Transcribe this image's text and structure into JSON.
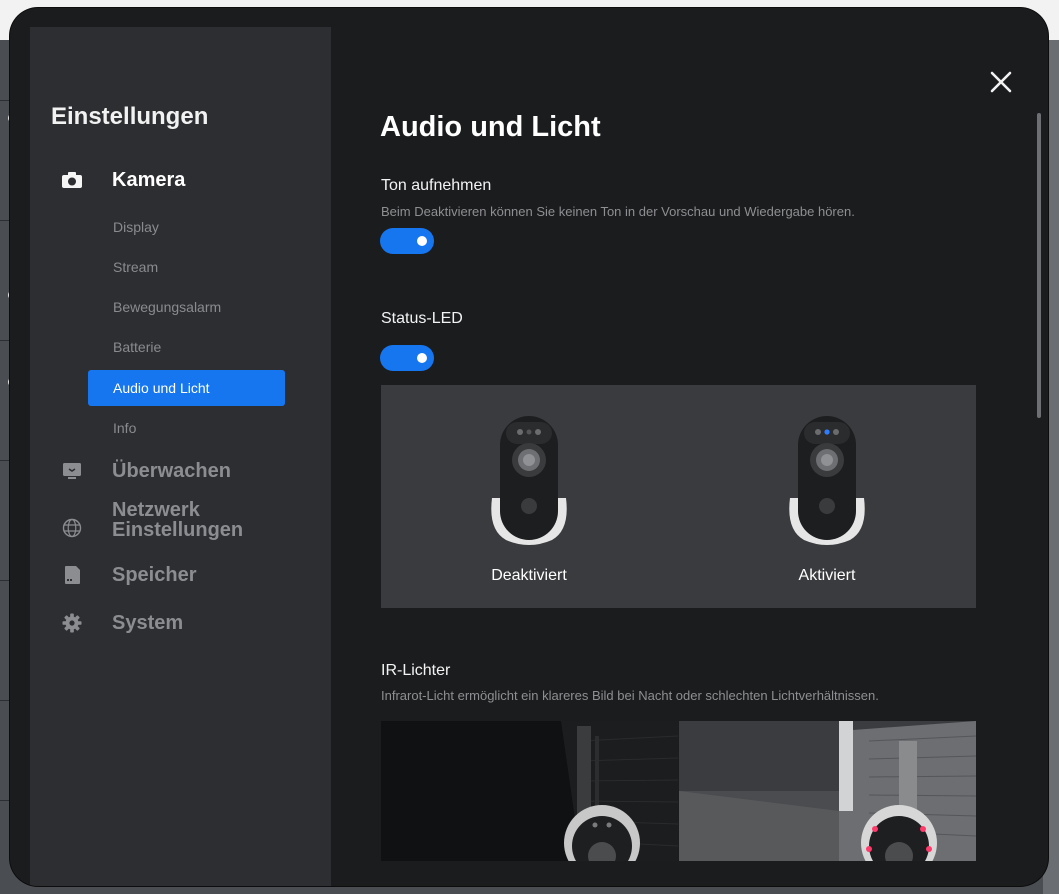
{
  "sidebar": {
    "title": "Einstellungen",
    "sections": [
      {
        "label": "Kamera",
        "icon": "camera-icon",
        "active": true
      },
      {
        "label": "Überwachen",
        "icon": "monitor-icon",
        "active": false
      },
      {
        "label": "Netzwerk\nEinstellungen",
        "icon": "globe-icon",
        "active": false
      },
      {
        "label": "Speicher",
        "icon": "sd-card-icon",
        "active": false
      },
      {
        "label": "System",
        "icon": "gear-icon",
        "active": false
      }
    ],
    "camera_items": [
      {
        "label": "Display"
      },
      {
        "label": "Stream"
      },
      {
        "label": "Bewegungsalarm"
      },
      {
        "label": "Batterie"
      },
      {
        "label": "Audio und Licht",
        "selected": true
      },
      {
        "label": "Info"
      }
    ]
  },
  "content": {
    "page_title": "Audio und Licht",
    "close_icon": "close-icon",
    "audio": {
      "label": "Ton aufnehmen",
      "description": "Beim Deaktivieren können Sie keinen Ton in der Vorschau und Wiedergabe hören.",
      "enabled": true
    },
    "status_led": {
      "label": "Status-LED",
      "enabled": true,
      "preview": {
        "off_label": "Deaktiviert",
        "on_label": "Aktiviert"
      }
    },
    "ir_lights": {
      "label": "IR-Lichter",
      "description": "Infrarot-Licht ermöglicht ein klareres Bild bei Nacht oder schlechten Lichtverhältnissen."
    }
  },
  "colors": {
    "accent": "#1576f0",
    "modal_bg": "#1b1c1e",
    "sidebar_bg": "#2d2e31",
    "panel_bg": "#3a3b3e"
  }
}
